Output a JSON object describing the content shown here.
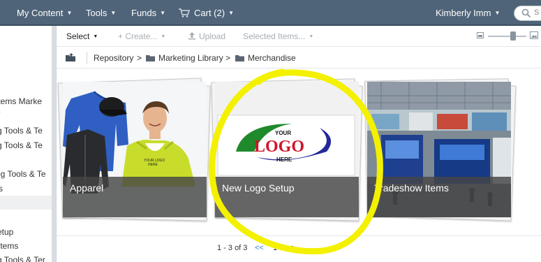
{
  "topnav": {
    "items": [
      {
        "label": "My Content"
      },
      {
        "label": "Tools"
      },
      {
        "label": "Funds"
      },
      {
        "label": "Cart (2)"
      }
    ],
    "user_name": "Kimberly Imm",
    "search_partial": "S"
  },
  "sidebar": {
    "items": [
      {
        "label": "Items Marke"
      },
      {
        "label": "/"
      },
      {
        "label": "g Tools & Te"
      },
      {
        "label": "g Tools & Te"
      },
      {
        "label": "ng Tools & Te"
      },
      {
        "label": "s"
      },
      {
        "label": "etup"
      },
      {
        "label": "Items"
      },
      {
        "label": "g Tools & Ter"
      }
    ]
  },
  "toolbar": {
    "select_label": "Select",
    "create_label": "Create...",
    "upload_label": "Upload",
    "selected_items_label": "Selected Items..."
  },
  "breadcrumb": {
    "items": [
      {
        "label": "Repository"
      },
      {
        "label": "Marketing Library"
      },
      {
        "label": "Merchandise"
      }
    ],
    "separator": ">"
  },
  "tiles": [
    {
      "label": "Apparel"
    },
    {
      "label": "New Logo Setup"
    },
    {
      "label": "Tradeshow Items"
    }
  ],
  "logo_art": {
    "line1": "YOUR",
    "line2": "LOGO",
    "line3": "HERE"
  },
  "hoodie_print": {
    "line1": "YOUR LOGO",
    "line2": "HERE"
  },
  "pager": {
    "range_text": "1 - 3 of 3",
    "prev": "<<",
    "page": "1",
    "next": ">>"
  },
  "colors": {
    "nav_bg": "#4f6479",
    "highlight": "#f3f000",
    "pager_link": "#2d7fd6"
  }
}
